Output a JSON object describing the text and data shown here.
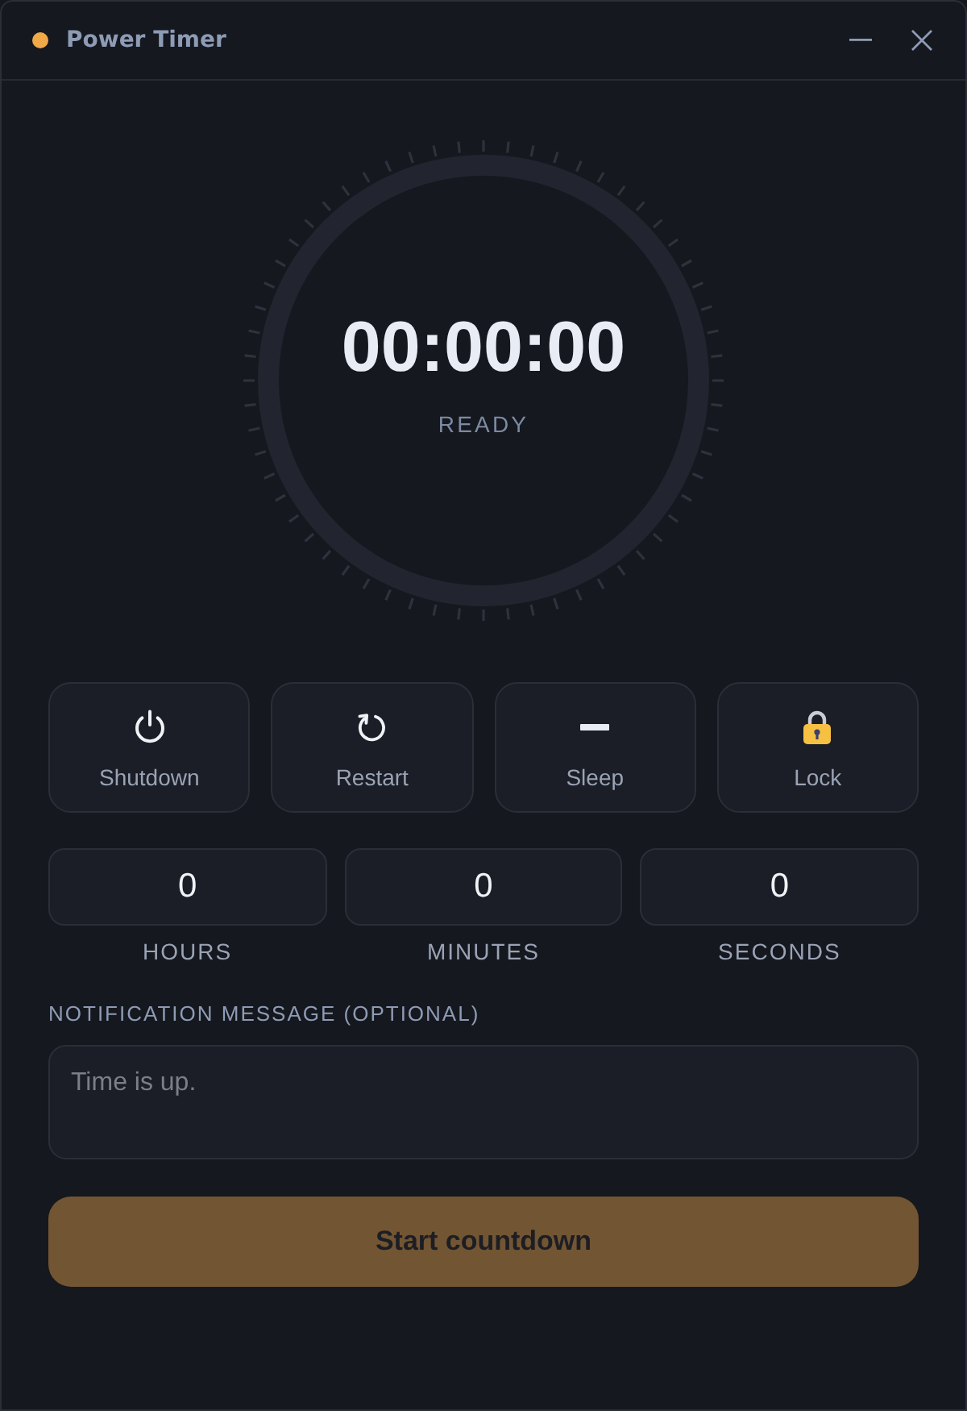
{
  "window": {
    "title": "Power Timer"
  },
  "timer": {
    "time": "00:00:00",
    "status": "READY"
  },
  "modes": [
    {
      "kind": "shutdown",
      "label": "Shutdown",
      "selected": false
    },
    {
      "kind": "restart",
      "label": "Restart",
      "selected": false
    },
    {
      "kind": "sleep",
      "label": "Sleep",
      "selected": false
    },
    {
      "kind": "lock",
      "label": "Lock",
      "selected": false
    }
  ],
  "duration_fields": [
    {
      "label": "HOURS",
      "value": "0"
    },
    {
      "label": "MINUTES",
      "value": "0"
    },
    {
      "label": "SECONDS",
      "value": "0"
    }
  ],
  "message": {
    "label": "NOTIFICATION MESSAGE (OPTIONAL)",
    "placeholder": "Time is up."
  },
  "start_button": {
    "label": "Start countdown",
    "disabled": true
  }
}
